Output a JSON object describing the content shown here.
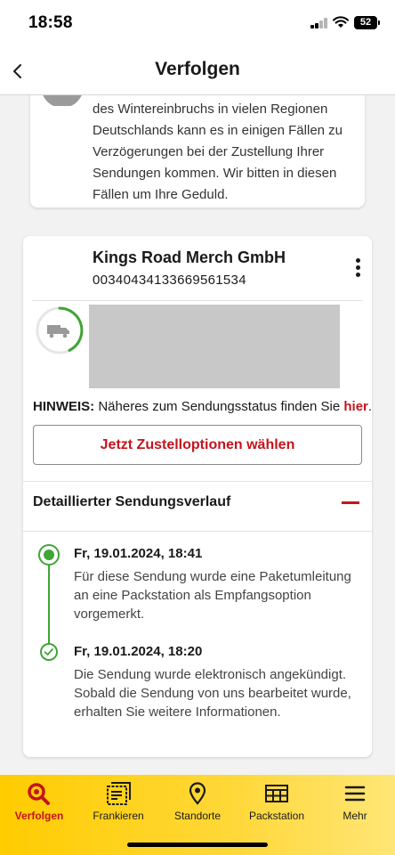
{
  "status_bar": {
    "time": "18:58",
    "battery": "52"
  },
  "header": {
    "title": "Verfolgen"
  },
  "notice": {
    "text": "des Wintereinbruchs in vielen Regionen Deutschlands kann es in einigen Fällen zu Verzögerungen bei der Zustellung Ihrer Sendungen kommen. Wir bitten in diesen Fällen um Ihre Geduld."
  },
  "shipment": {
    "sender": "Kings Road Merch GmbH",
    "tracking_number": "00340434133669561534",
    "hint_label": "HINWEIS:",
    "hint_text": "Näheres zum Sendungsstatus finden Sie",
    "hint_link": "hier",
    "hint_end": ".",
    "delivery_button": "Jetzt Zustelloptionen wählen",
    "history_title": "Detaillierter Sendungsverlauf",
    "events": [
      {
        "date": "Fr, 19.01.2024, 18:41",
        "text": "Für diese Sendung wurde eine Paketumleitung an eine Packstation als Empfangsoption vorgemerkt."
      },
      {
        "date": "Fr, 19.01.2024, 18:20",
        "text": "Die Sendung wurde elektronisch angekündigt. Sobald die Sendung von uns bearbeitet wurde, erhalten Sie weitere Informationen."
      }
    ]
  },
  "nav": {
    "items": [
      {
        "label": "Verfolgen",
        "icon": "search-icon"
      },
      {
        "label": "Frankieren",
        "icon": "stamp-icon"
      },
      {
        "label": "Standorte",
        "icon": "location-pin-icon"
      },
      {
        "label": "Packstation",
        "icon": "packstation-icon"
      },
      {
        "label": "Mehr",
        "icon": "menu-icon"
      }
    ]
  },
  "colors": {
    "accent_red": "#c4141c",
    "brand_yellow": "#ffcc00",
    "status_green": "#3fa535"
  }
}
